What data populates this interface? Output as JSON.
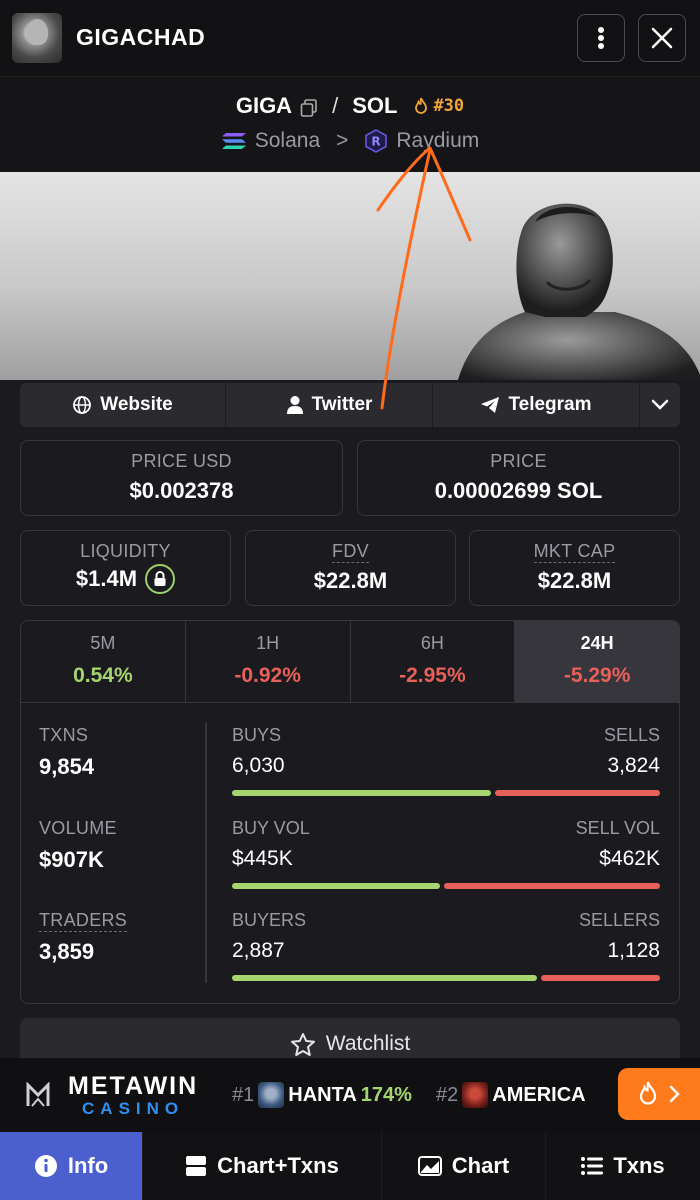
{
  "header": {
    "title": "GIGACHAD"
  },
  "pair": {
    "base": "GIGA",
    "separator": "/",
    "quote": "SOL",
    "rank": "#30",
    "chain": "Solana",
    "chevron": ">",
    "dex": "Raydium"
  },
  "socials": {
    "website": "Website",
    "twitter": "Twitter",
    "telegram": "Telegram"
  },
  "prices": {
    "usd_label": "PRICE USD",
    "usd_value": "$0.002378",
    "native_label": "PRICE",
    "native_value": "0.00002699 SOL"
  },
  "metrics": {
    "liquidity_label": "LIQUIDITY",
    "liquidity_value": "$1.4M",
    "fdv_label": "FDV",
    "fdv_value": "$22.8M",
    "mcap_label": "MKT CAP",
    "mcap_value": "$22.8M"
  },
  "timeframes": [
    {
      "label": "5M",
      "value": "0.54%"
    },
    {
      "label": "1H",
      "value": "-0.92%"
    },
    {
      "label": "6H",
      "value": "-2.95%"
    },
    {
      "label": "24H",
      "value": "-5.29%"
    }
  ],
  "txns": {
    "txns_label": "TXNS",
    "txns_value": "9,854",
    "volume_label": "VOLUME",
    "volume_value": "$907K",
    "traders_label": "TRADERS",
    "traders_value": "3,859",
    "buys_label": "BUYS",
    "buys_value": "6,030",
    "sells_label": "SELLS",
    "sells_value": "3,824",
    "buyvol_label": "BUY VOL",
    "buyvol_value": "$445K",
    "sellvol_label": "SELL VOL",
    "sellvol_value": "$462K",
    "buyers_label": "BUYERS",
    "buyers_value": "2,887",
    "sellers_label": "SELLERS",
    "sellers_value": "1,128"
  },
  "ratios": {
    "buys_share": 0.612,
    "buyvol_share": 0.491,
    "buyers_share": 0.719
  },
  "watchlist": {
    "label": "Watchlist"
  },
  "ticker": {
    "sponsor_top": "METAWIN",
    "sponsor_bottom": "CASINO",
    "items": [
      {
        "rank": "#1",
        "name": "HANTA",
        "change": "174%"
      },
      {
        "rank": "#2",
        "name": "AMERICA"
      }
    ]
  },
  "nav": {
    "info": "Info",
    "chart_txns": "Chart+Txns",
    "chart": "Chart",
    "txns": "Txns"
  },
  "colors": {
    "positive": "#a6d46f",
    "negative": "#e8605a",
    "accent": "#4c5fce",
    "rank": "#f4a23a",
    "fire": "#ff7a1a"
  }
}
